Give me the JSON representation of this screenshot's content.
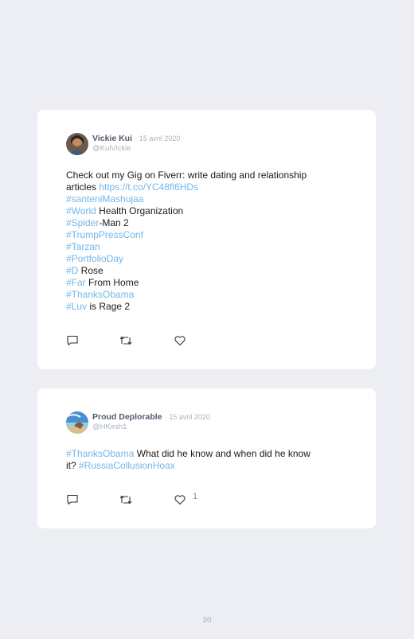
{
  "tweets": [
    {
      "name": "Vickie Kui",
      "separator": "·",
      "date": "15 avril 2020",
      "handle": "@KuiVickie",
      "line1": "Check out my Gig on Fiverr: write dating and relationship",
      "line2_text": "articles ",
      "line2_link": "https://t.co/YC48fl6HDs",
      "tags": [
        {
          "tag": "#santeniMashujaa",
          "rest": ""
        },
        {
          "tag": "#World",
          "rest": " Health Organization"
        },
        {
          "tag": "#Spider",
          "rest": "-Man 2"
        },
        {
          "tag": "#TrumpPressConf",
          "rest": ""
        },
        {
          "tag": "#Tarzan",
          "rest": ""
        },
        {
          "tag": "#PortfolioDay",
          "rest": ""
        },
        {
          "tag": "#D",
          "rest": " Rose"
        },
        {
          "tag": "#Far",
          "rest": " From Home"
        },
        {
          "tag": "#ThanksObama",
          "rest": ""
        },
        {
          "tag": "#Luv",
          "rest": " is Rage 2"
        }
      ],
      "like_count": ""
    },
    {
      "name": "Proud Deplorable",
      "separator": "·",
      "date": "15 avril 2020",
      "handle": "@HKirsh1",
      "line1_tag": "#ThanksObama",
      "line1_text": " What did he know and when did he know",
      "line2_text": "it? ",
      "line2_tag": "#RussiaCollusionHoax",
      "like_count": "1"
    }
  ],
  "page_number": "20",
  "icons": {
    "reply": "comment-bubble-icon",
    "retweet": "retweet-arrows-icon",
    "like": "heart-outline-icon"
  },
  "colors": {
    "link": "#73b6e8",
    "name": "#505a6e",
    "meta": "#aab0bc",
    "background": "#eceef4"
  }
}
